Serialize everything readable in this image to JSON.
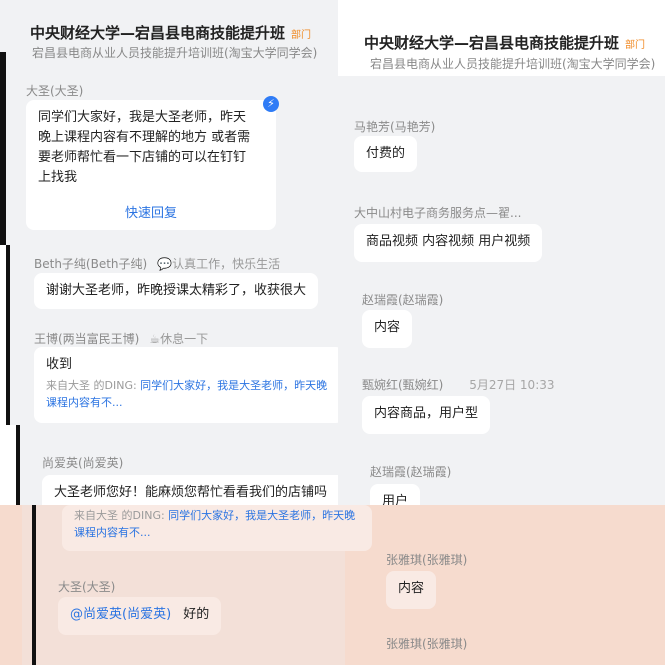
{
  "header": {
    "title": "中央财经大学—宕昌县电商技能提升班",
    "department_tag": "部门",
    "subtitle_left": "宕昌县电商从业人员技能提升培训班(淘宝大学同学会)",
    "subtitle_right": "宕昌县电商从业人员技能提升培训班(淘宝大学同学会)"
  },
  "left_chat": [
    {
      "sender": "大圣(大圣)",
      "lines": [
        "同学们大家好，我是大圣老师，昨天",
        "晚上课程内容有不理解的地方 或者需",
        "要老师帮忙看一下店铺的可以在钉钉",
        "上找我"
      ],
      "action": "快速回复",
      "ding_icon": "ding-icon"
    },
    {
      "sender": "Beth子纯(Beth子纯)",
      "signature": "认真工作，快乐生活",
      "text": "谢谢大圣老师，昨晚授课太精彩了，收获很大"
    },
    {
      "sender": "王博(两当富民王博)",
      "signature": "休息一下",
      "text": "收到",
      "quote_prefix": "来自大圣 的DING:",
      "quote_text": "同学们大家好，我是大圣老师，昨天晚",
      "quote_more": "课程内容有不..."
    },
    {
      "sender": "尚爱英(尚爱英)",
      "text": "大圣老师您好！能麻烦您帮忙看看我们的店铺吗",
      "quote_prefix": "来自大圣 的DING:",
      "quote_text": "同学们大家好，我是大圣老师，昨天晚",
      "quote_more": "课程内容有不..."
    },
    {
      "sender": "大圣(大圣)",
      "mention": "@尚爱英(尚爱英)",
      "text": "好的"
    }
  ],
  "right_chat": [
    {
      "sender": "马艳芳(马艳芳)",
      "text": "付费的"
    },
    {
      "sender": "大中山村电子商务服务点—翟...",
      "text": "商品视频 内容视频  用户视频"
    },
    {
      "sender": "赵瑞霞(赵瑞霞)",
      "text": "内容"
    },
    {
      "sender": "甄婉红(甄婉红)",
      "time": "5月27日 10:33",
      "text": "内容商品，用户型"
    },
    {
      "sender": "赵瑞霞(赵瑞霞)",
      "text": "用户"
    },
    {
      "sender": "张雅琪(张雅琪)",
      "text": "内容"
    },
    {
      "sender": "张雅琪(张雅琪)"
    }
  ],
  "colors": {
    "chat_bg": "#f1f2f4",
    "header_bg": "#ffffff",
    "overlay_bg": "#f6dbce",
    "link": "#2b74e2",
    "tag": "#f08a24"
  }
}
